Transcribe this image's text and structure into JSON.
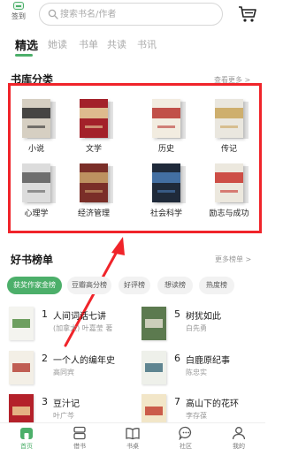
{
  "header": {
    "signin_label": "签到",
    "search_placeholder": "搜索书名/作者"
  },
  "tabs": [
    {
      "label": "精选",
      "active": true
    },
    {
      "label": "她读",
      "active": false
    },
    {
      "label": "书单",
      "active": false
    },
    {
      "label": "共读",
      "active": false
    },
    {
      "label": "书讯",
      "active": false
    }
  ],
  "library": {
    "title": "书库分类",
    "more_label": "查看更多 >",
    "categories": [
      {
        "label": "小说",
        "cover_colors": [
          "#d6cfc2",
          "#2d2d2d"
        ]
      },
      {
        "label": "文学",
        "cover_colors": [
          "#a3212a",
          "#e9d6a0"
        ]
      },
      {
        "label": "历史",
        "cover_colors": [
          "#f2ece0",
          "#b8352e"
        ]
      },
      {
        "label": "传记",
        "cover_colors": [
          "#eae7df",
          "#c9a45a"
        ]
      },
      {
        "label": "心理学",
        "cover_colors": [
          "#dcdcdc",
          "#5a5a5a"
        ]
      },
      {
        "label": "经济管理",
        "cover_colors": [
          "#7a2e28",
          "#c9a26a"
        ]
      },
      {
        "label": "社会科学",
        "cover_colors": [
          "#1f2a3a",
          "#4a7bb5"
        ]
      },
      {
        "label": "励志与成功",
        "cover_colors": [
          "#ece8de",
          "#c8322c"
        ]
      }
    ]
  },
  "rankings": {
    "title": "好书榜单",
    "more_label": "更多榜单 >",
    "pills": [
      {
        "label": "获奖作家金榜",
        "active": true
      },
      {
        "label": "豆瓣高分榜",
        "active": false
      },
      {
        "label": "好评榜",
        "active": false
      },
      {
        "label": "想读榜",
        "active": false
      },
      {
        "label": "热度榜",
        "active": false
      }
    ],
    "items": [
      {
        "num": "1",
        "title": "人间词话七讲",
        "author": "(加拿大) 叶嘉莹 著",
        "cover_colors": [
          "#f4f4ef",
          "#4c8a3c"
        ]
      },
      {
        "num": "5",
        "title": "树犹如此",
        "author": "白先勇",
        "cover_colors": [
          "#5c7a4f",
          "#e8e3d5"
        ]
      },
      {
        "num": "2",
        "title": "一个人的编年史",
        "author": "高同宾",
        "cover_colors": [
          "#f3efe6",
          "#b33a2e"
        ]
      },
      {
        "num": "6",
        "title": "白鹿原纪事",
        "author": "陈忠实",
        "cover_colors": [
          "#eef0ea",
          "#3b6a7a"
        ]
      },
      {
        "num": "3",
        "title": "豆汁记",
        "author": "叶广芩",
        "cover_colors": [
          "#b4212a",
          "#f0d79a"
        ]
      },
      {
        "num": "7",
        "title": "高山下的花环",
        "author": "李存葆",
        "cover_colors": [
          "#f2e6c8",
          "#c0392b"
        ]
      }
    ]
  },
  "bottom_nav": [
    {
      "label": "首页",
      "icon": "home-icon",
      "active": true
    },
    {
      "label": "借书",
      "icon": "borrow-icon",
      "active": false
    },
    {
      "label": "书桌",
      "icon": "desk-icon",
      "active": false
    },
    {
      "label": "社区",
      "icon": "community-icon",
      "active": false
    },
    {
      "label": "我的",
      "icon": "profile-icon",
      "active": false
    }
  ],
  "colors": {
    "accent": "#4caf6a",
    "highlight_box": "#f0242a"
  }
}
